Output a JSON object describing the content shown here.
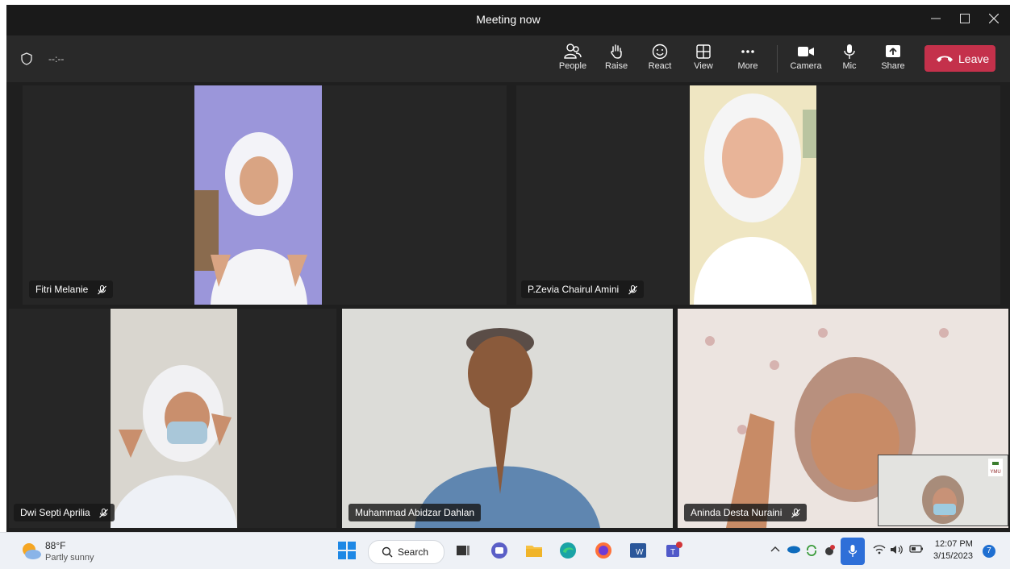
{
  "window": {
    "title": "Meeting now"
  },
  "toolbar": {
    "timer": "--:--",
    "buttons": [
      {
        "label": "People",
        "icon": "people-icon"
      },
      {
        "label": "Raise",
        "icon": "raise-hand-icon"
      },
      {
        "label": "React",
        "icon": "react-smiley-icon"
      },
      {
        "label": "View",
        "icon": "view-grid-icon"
      },
      {
        "label": "More",
        "icon": "more-dots-icon"
      },
      {
        "label": "Camera",
        "icon": "camera-icon"
      },
      {
        "label": "Mic",
        "icon": "microphone-icon"
      },
      {
        "label": "Share",
        "icon": "share-screen-icon"
      }
    ],
    "leave_label": "Leave"
  },
  "participants": [
    {
      "name": "Fitri Melanie",
      "muted": true
    },
    {
      "name": "P.Zevia Chairul Amini",
      "muted": true
    },
    {
      "name": "Dwi Septi Aprilia",
      "muted": true
    },
    {
      "name": "Muhammad Abidzar Dahlan",
      "muted": false
    },
    {
      "name": "Aninda Desta Nuraini",
      "muted": true
    }
  ],
  "self_view": {
    "logo_text": "YMU"
  },
  "taskbar": {
    "weather": {
      "temp": "88°F",
      "desc": "Partly sunny"
    },
    "search_label": "Search",
    "clock": {
      "time": "12:07 PM",
      "date": "3/15/2023"
    },
    "notification_count": "7"
  },
  "colors": {
    "leave": "#c4314b",
    "toolbar_bg": "#292929",
    "title_bg": "#1a1a1a",
    "taskbar_bg": "#eef1f6"
  }
}
